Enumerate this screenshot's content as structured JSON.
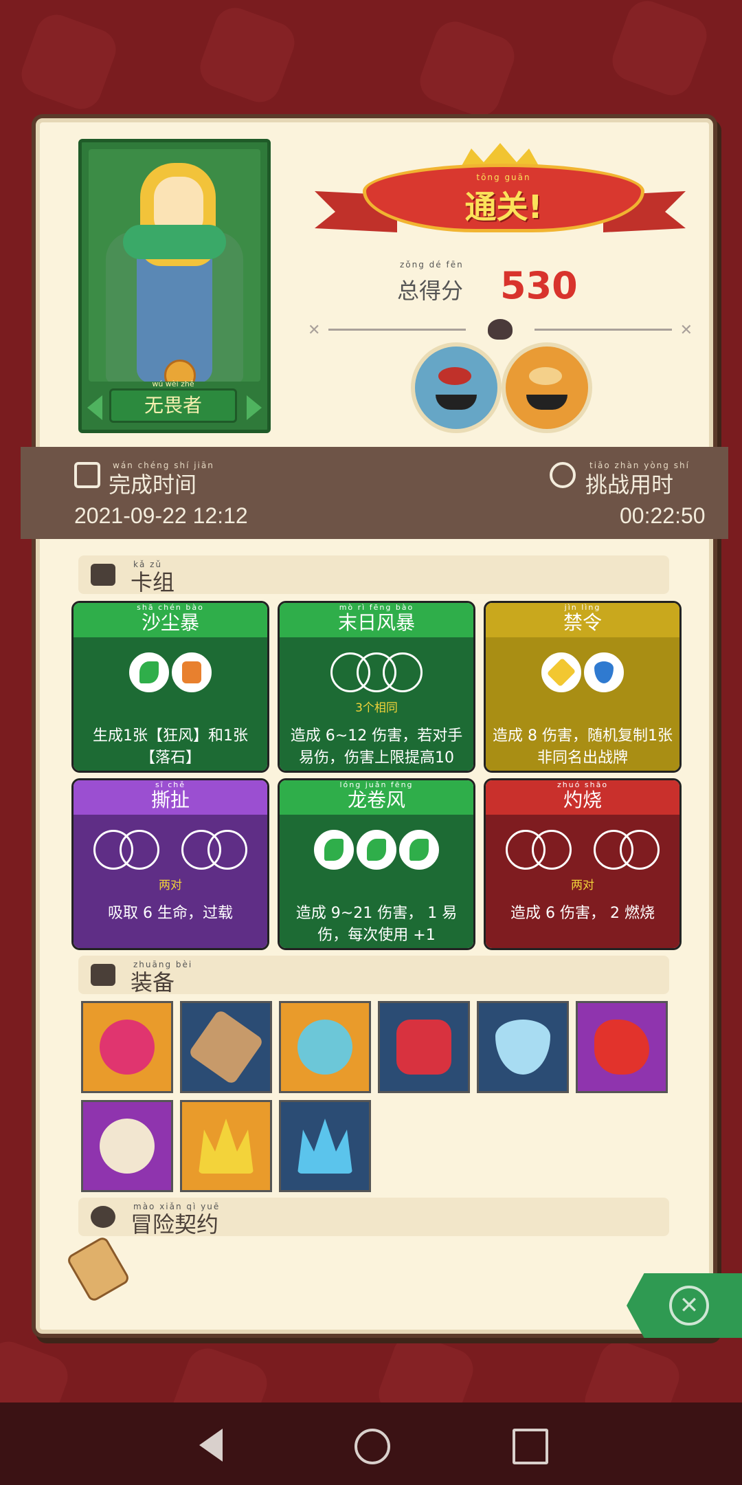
{
  "hero": {
    "name": "无畏者",
    "name_ruby": "wú wèi zhě"
  },
  "result": {
    "title": "通关!",
    "title_ruby": "tōng guān",
    "score_label": "总得分",
    "score_ruby": "zǒng dé fēn",
    "score_value": "530"
  },
  "stats": {
    "complete_label": "完成时间",
    "complete_ruby": "wán chéng shí jiān",
    "complete_value": "2021-09-22  12:12",
    "challenge_label": "挑战用时",
    "challenge_ruby": "tiǎo zhàn yòng shí",
    "challenge_value": "00:22:50"
  },
  "deck": {
    "section_label": "卡组",
    "section_ruby": "kǎ zǔ",
    "cards": [
      {
        "title": "沙尘暴",
        "ruby": "shā chén bào",
        "sub": "",
        "desc": "生成1张【狂风】和1张【落石】"
      },
      {
        "title": "末日风暴",
        "ruby": "mò rì fēng bào",
        "sub": "3个相同",
        "desc": "造成 6~12 伤害，若对手 易伤，伤害上限提高10"
      },
      {
        "title": "禁令",
        "ruby": "jìn lìng",
        "sub": "",
        "desc": "造成 8 伤害，随机复制1张非同名出战牌"
      },
      {
        "title": "撕扯",
        "ruby": "sī chě",
        "sub": "两对",
        "desc": "吸取 6 生命，过载"
      },
      {
        "title": "龙卷风",
        "ruby": "lóng juǎn fēng",
        "sub": "",
        "desc": "造成 9~21 伤害， 1 易伤，每次使用 +1"
      },
      {
        "title": "灼烧",
        "ruby": "zhuó shāo",
        "sub": "两对",
        "desc": "造成 6 伤害， 2 燃烧"
      }
    ]
  },
  "equipment": {
    "section_label": "装备",
    "section_ruby": "zhuāng bèi",
    "items": [
      "orb-icon",
      "horn-icon",
      "ghost-icon",
      "ruby-icon",
      "crystal-icon",
      "dragon-icon",
      "mask-icon",
      "crown-icon",
      "ice-crown-icon"
    ]
  },
  "contract": {
    "section_label": "冒险契约",
    "section_ruby": "mào xiǎn qì yuē"
  }
}
